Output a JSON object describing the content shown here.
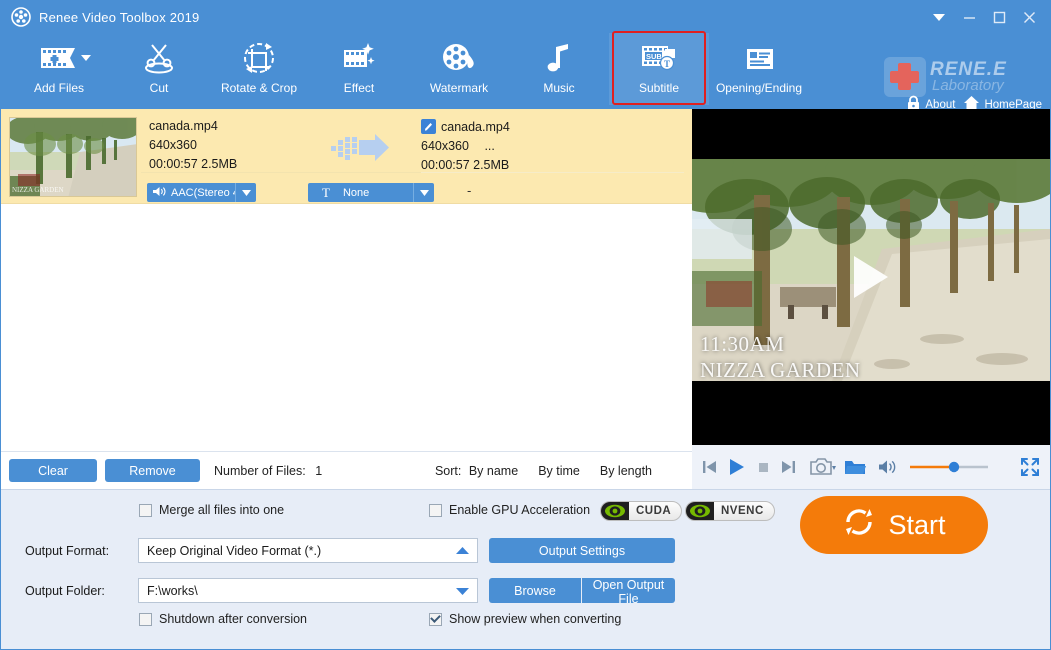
{
  "window": {
    "title": "Renee Video Toolbox 2019",
    "controls": {
      "collapse": "▼",
      "minimize": "—",
      "maximize": "☐",
      "close": "✕"
    }
  },
  "brand": {
    "name": "RENE.E",
    "sub": "Laboratory",
    "about_label": "About",
    "homepage_label": "HomePage"
  },
  "toolbar": {
    "items": [
      {
        "label": "Add Files",
        "icon": "add-files-icon",
        "has_caret": true,
        "active": false
      },
      {
        "label": "Cut",
        "icon": "cut-icon",
        "has_caret": false,
        "active": false
      },
      {
        "label": "Rotate & Crop",
        "icon": "rotate-crop-icon",
        "has_caret": false,
        "active": false
      },
      {
        "label": "Effect",
        "icon": "effect-icon",
        "has_caret": false,
        "active": false
      },
      {
        "label": "Watermark",
        "icon": "watermark-icon",
        "has_caret": false,
        "active": false
      },
      {
        "label": "Music",
        "icon": "music-icon",
        "has_caret": false,
        "active": false
      },
      {
        "label": "Subtitle",
        "icon": "subtitle-icon",
        "has_caret": false,
        "active": true
      },
      {
        "label": "Opening/Ending",
        "icon": "opening-ending-icon",
        "has_caret": false,
        "active": false
      }
    ],
    "highlight_color": "#e02020",
    "background_color": "#4a8fd4"
  },
  "file_list": {
    "row": {
      "source": {
        "name": "canada.mp4",
        "resolution": "640x360",
        "duration_size": "00:00:57  2.5MB"
      },
      "output": {
        "name": "canada.mp4",
        "resolution": "640x360",
        "resolution_more": "...",
        "duration_size": "00:00:57  2.5MB",
        "status": "-"
      },
      "audio_track": "AAC(Stereo 4",
      "subtitle_track": "None"
    }
  },
  "list_toolbar": {
    "clear_label": "Clear",
    "remove_label": "Remove",
    "number_of_files_label": "Number of Files:",
    "number_of_files_value": "1",
    "sort_label": "Sort:",
    "sort_options": [
      "By name",
      "By time",
      "By length"
    ]
  },
  "preview": {
    "subtitle_line1": "11:30AM",
    "subtitle_line2": "NIZZA GARDEN",
    "controls": [
      "previous-icon",
      "play-icon",
      "stop-icon",
      "next-icon",
      "snapshot-icon",
      "snapshot-dropdown-icon",
      "open-folder-icon",
      "volume-icon",
      "volume-slider",
      "fullscreen-icon"
    ],
    "volume_value": 55
  },
  "settings": {
    "merge_label": "Merge all files into one",
    "merge_checked": false,
    "gpu_label": "Enable GPU Acceleration",
    "gpu_checked": false,
    "gpu_badges": [
      "CUDA",
      "NVENC"
    ],
    "output_format_label": "Output Format:",
    "output_format_value": "Keep Original Video Format (*.)",
    "output_format_caret": "up",
    "output_settings_label": "Output Settings",
    "output_folder_label": "Output Folder:",
    "output_folder_value": "F:\\works\\",
    "output_folder_caret": "down",
    "browse_label": "Browse",
    "open_output_label": "Open Output File",
    "shutdown_label": "Shutdown after conversion",
    "shutdown_checked": false,
    "show_preview_label": "Show preview when converting",
    "show_preview_checked": true,
    "start_label": "Start"
  },
  "colors": {
    "accent_blue": "#4a8fd4",
    "row_highlight": "#fce9b0",
    "start_orange": "#f47b0a",
    "panel_bg": "#e7edf7"
  }
}
